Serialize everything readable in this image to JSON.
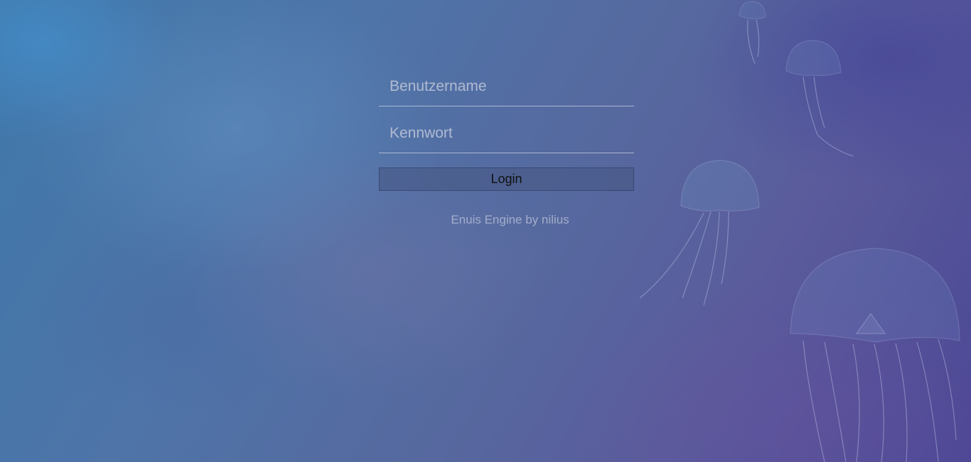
{
  "login": {
    "username_placeholder": "Benutzername",
    "username_value": "",
    "password_placeholder": "Kennwort",
    "password_value": "",
    "submit_label": "Login"
  },
  "footer": {
    "credit": "Enuis Engine by nilius"
  },
  "theme": {
    "background_top_left": "#3f78aa",
    "background_bottom_right": "#4a4794",
    "field_line": "#d2d7e6",
    "button_fill": "#465582"
  }
}
